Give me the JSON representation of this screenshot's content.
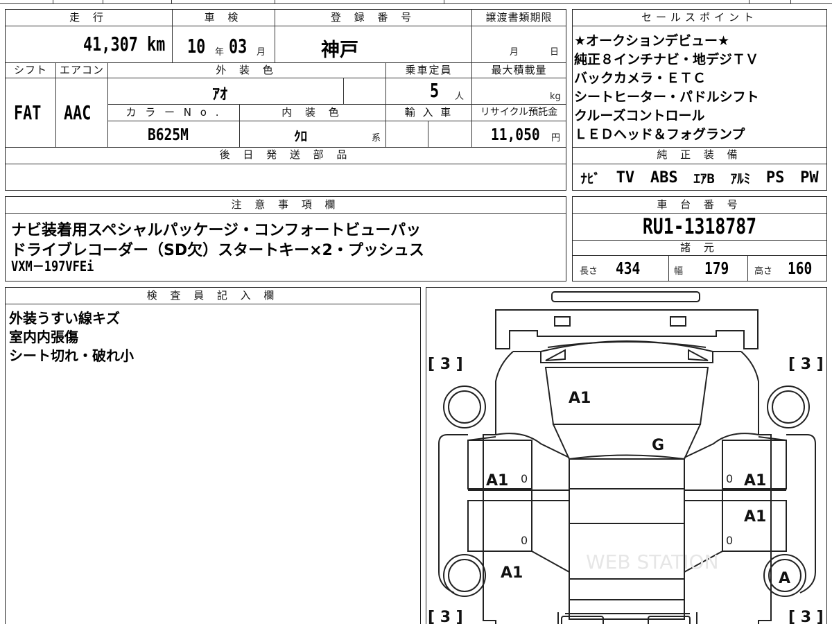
{
  "vehicle_info": {
    "headers": {
      "mileage": "走 行",
      "inspection": "車 検",
      "registration": "登 録 番 号",
      "transfer_deadline": "譲渡書類期限",
      "shift": "シフト",
      "aircon": "エアコン",
      "exterior_color": "外 装 色",
      "capacity": "乗車定員",
      "max_load": "最大積載量",
      "color_no": "カ ラ ー N o .",
      "interior_color": "内 装 色",
      "import": "輸 入 車",
      "recycle": "リサイクル預託金",
      "later_parts": "後 日 発 送 部 品"
    },
    "mileage_value": "41,307",
    "mileage_unit": "km",
    "inspection_year": "10",
    "year_unit": "年",
    "inspection_month": "03",
    "month_unit": "月",
    "registration_value": "神戸",
    "deadline_month_unit": "月",
    "deadline_day_unit": "日",
    "shift_value": "FAT",
    "aircon_value": "AAC",
    "exterior_value": "ｱｵ",
    "capacity_value": "5",
    "capacity_unit": "人",
    "max_load_unit": "kg",
    "color_no_value": "B625M",
    "interior_value": "ｸﾛ",
    "interior_unit": "系",
    "recycle_value": "11,050",
    "recycle_unit": "円"
  },
  "sales_points": {
    "header": "セールスポイント",
    "lines": [
      "★オークションデビュー★",
      "純正８インチナビ・地デジＴＶ",
      "バックカメラ・ＥＴＣ",
      "シートヒーター・パドルシフト",
      "クルーズコントロール",
      "ＬＥＤヘッド＆フォグランプ"
    ]
  },
  "standard_equipment": {
    "header": "純 正 装 備",
    "items": [
      "ﾅﾋﾞ",
      "TV",
      "ABS",
      "ｴｱB",
      "ｱﾙﾐ",
      "PS",
      "PW"
    ]
  },
  "notes": {
    "header": "注 意 事 項 欄",
    "lines": [
      "ナビ装着用スペシャルパッケージ・コンフォートビューパッ",
      "ドライブレコーダー（SD欠）スタートキー×2・プッシュス",
      "VXM－197VFEi"
    ]
  },
  "chassis": {
    "header": "車 台 番 号",
    "value": "RU1-1318787"
  },
  "specs": {
    "header": "諸 元",
    "length_label": "長さ",
    "length_value": "434",
    "width_label": "幅",
    "width_value": "179",
    "height_label": "高さ",
    "height_value": "160"
  },
  "inspector": {
    "header": "検 査 員 記 入 欄",
    "lines": [
      "外装うすい線キズ",
      "室内内張傷",
      "シート切れ・破れ小"
    ]
  },
  "diagram": {
    "tire_fl": "[ 3 ]",
    "tire_fr": "[ 3 ]",
    "tire_rl": "[ 3 ]",
    "tire_rr": "[ 3 ]",
    "zero": "0",
    "marks": {
      "hood": "A1",
      "windshield": "G",
      "left_front_door": "A1",
      "right_front_door": "A1",
      "right_rear_door": "A1",
      "left_rear_fender": "A1",
      "right_rear_wheel": "A"
    },
    "watermark": "WEB STATION"
  }
}
